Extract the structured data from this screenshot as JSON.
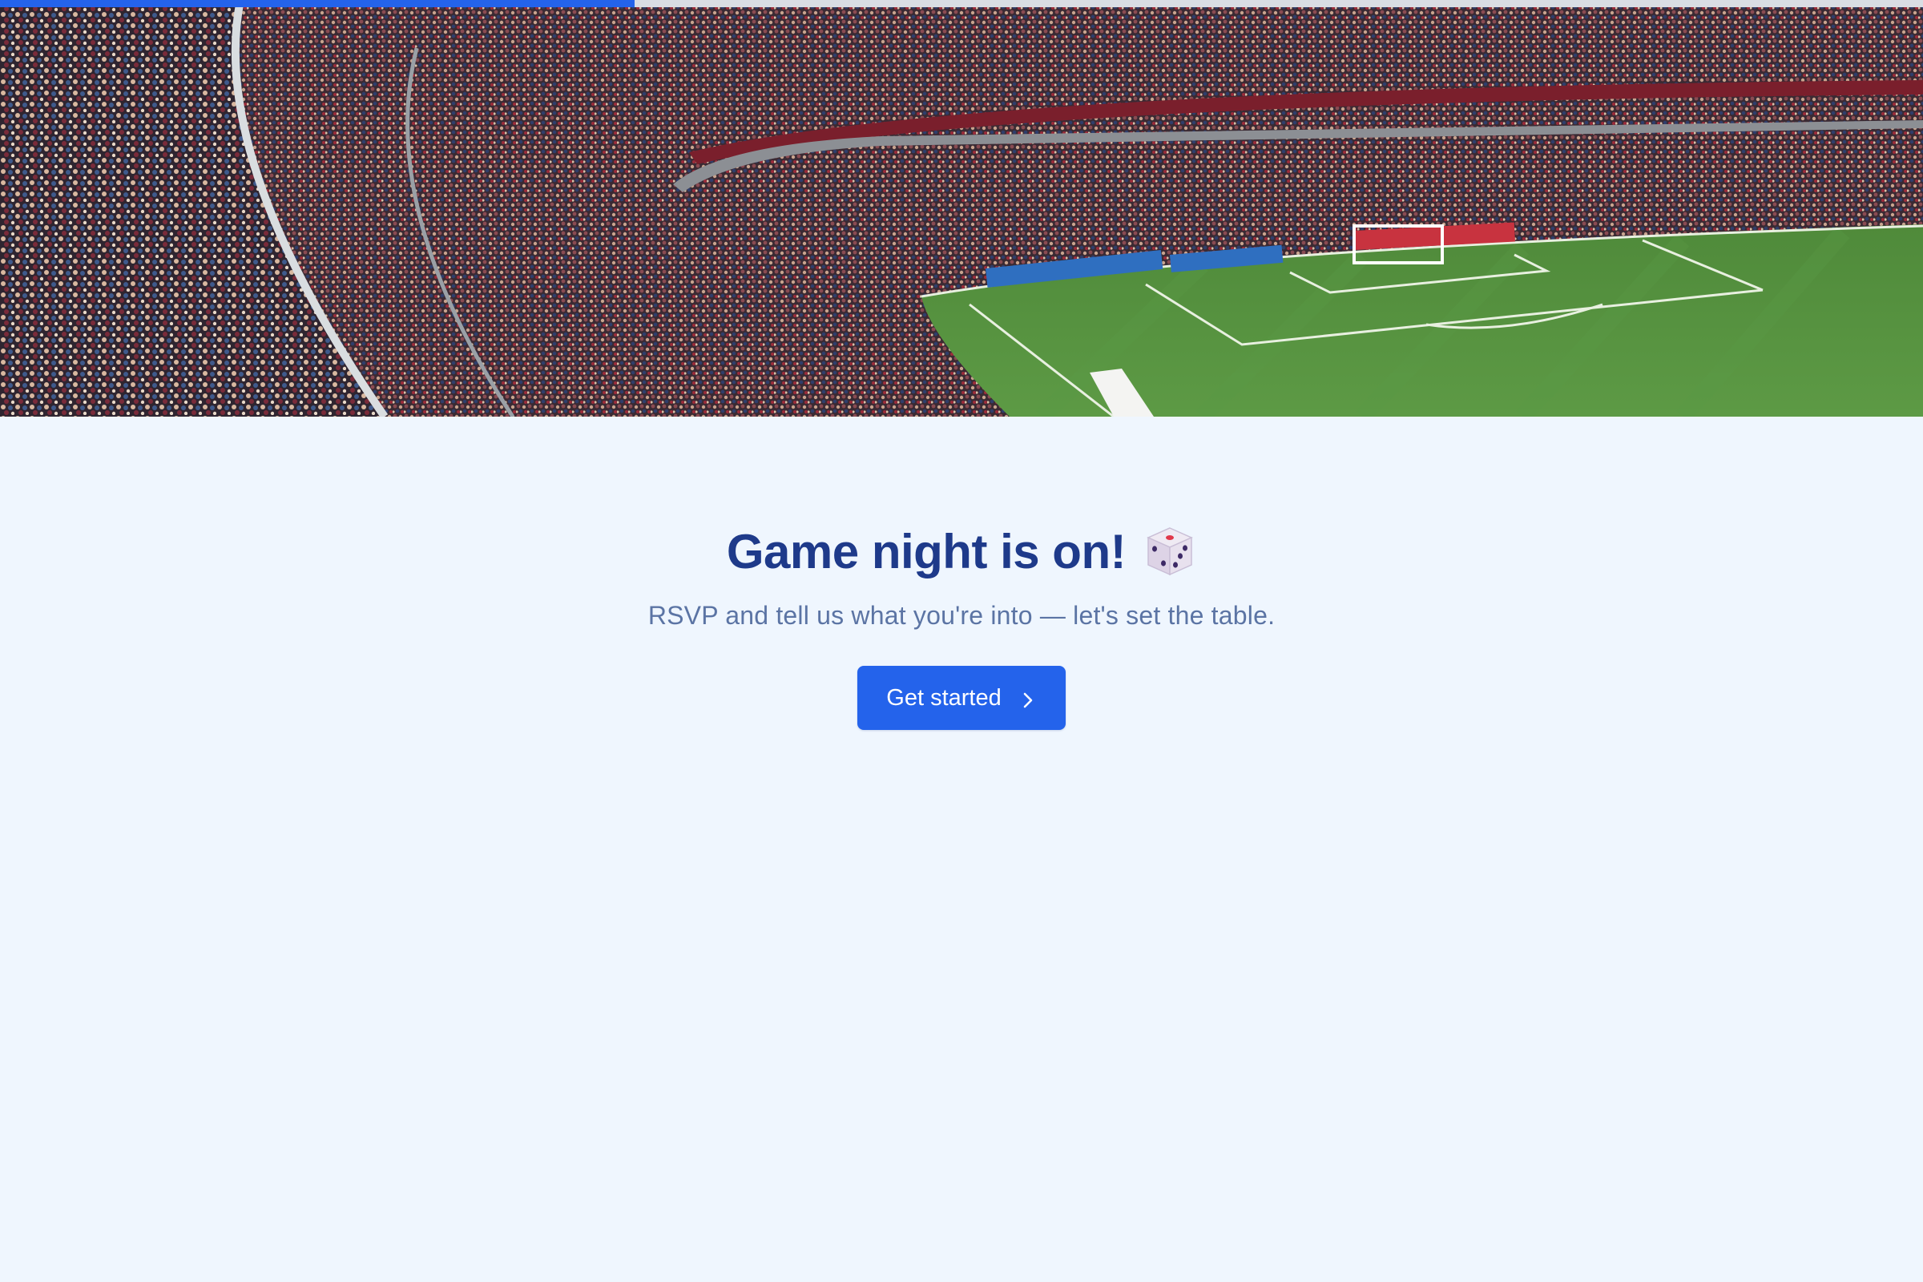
{
  "progress": {
    "fraction": 0.33,
    "color": "#2463eb"
  },
  "hero": {
    "image": "stadium-crowd-photo"
  },
  "main": {
    "title": "Game night is on!",
    "title_icon": "dice-icon",
    "subtitle": "RSVP and tell us what you're into — let's set the table.",
    "cta_label": "Get started",
    "cta_icon": "chevron-right-icon"
  },
  "colors": {
    "background": "#eff6fe",
    "title": "#1e3a8a",
    "subtitle": "#5b74a4",
    "accent": "#2463eb"
  }
}
